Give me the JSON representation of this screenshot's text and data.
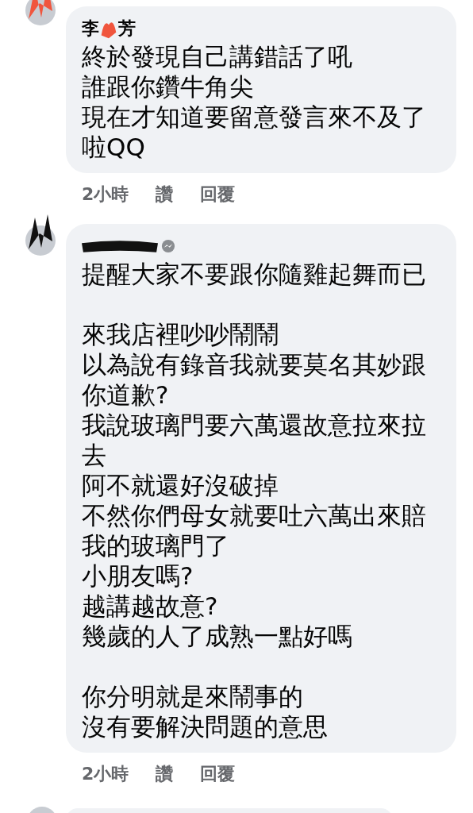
{
  "comments": [
    {
      "name_parts": [
        "李",
        "芳"
      ],
      "name_redacted": true,
      "messenger": false,
      "blocks": [
        [
          "終於發現自己講錯話了吼",
          "誰跟你鑽牛角尖",
          "現在才知道要留意發言來不及了",
          "啦QQ"
        ]
      ],
      "time": "2小時",
      "actions": [
        "讚",
        "回覆"
      ]
    },
    {
      "name_redacted": true,
      "messenger": true,
      "blocks": [
        [
          "提醒大家不要跟你隨雞起舞而已"
        ],
        [
          "來我店裡吵吵鬧鬧",
          "以為說有錄音我就要莫名其妙跟",
          "你道歉?",
          "我說玻璃門要六萬還故意拉來拉",
          "去",
          "阿不就還好沒破掉",
          "不然你們母女就要吐六萬出來賠",
          "我的玻璃門了",
          "小朋友嗎?",
          "越講越故意?",
          "幾歲的人了成熟一點好嗎"
        ],
        [
          "你分明就是來鬧事的",
          "沒有要解決問題的意思"
        ]
      ],
      "time": "2小時",
      "actions": [
        "讚",
        "回覆"
      ]
    }
  ]
}
